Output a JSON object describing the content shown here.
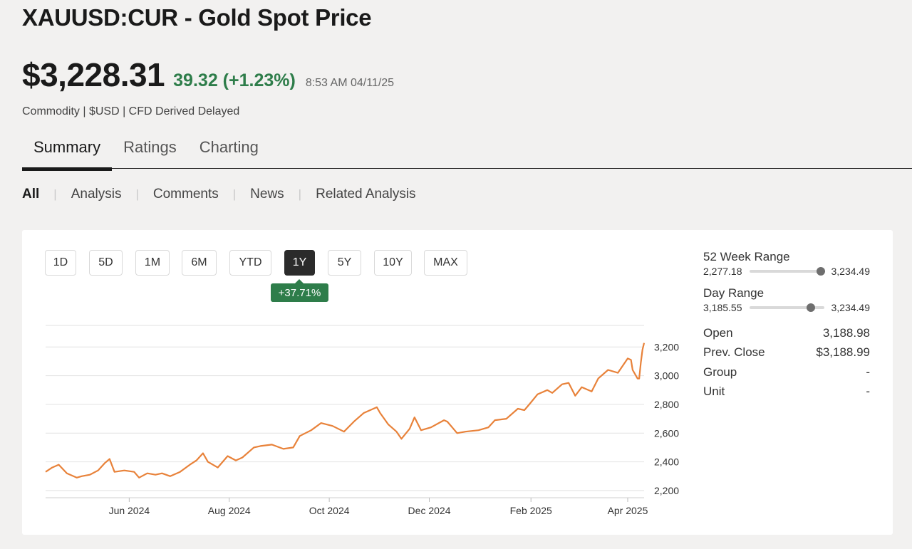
{
  "header": {
    "title": "XAUUSD:CUR - Gold Spot Price",
    "price": "$3,228.31",
    "change": "39.32 (+1.23%)",
    "time": "8:53 AM 04/11/25",
    "subtitle": "Commodity | $USD | CFD Derived Delayed"
  },
  "tabs": [
    "Summary",
    "Ratings",
    "Charting"
  ],
  "subnav": [
    "All",
    "Analysis",
    "Comments",
    "News",
    "Related Analysis"
  ],
  "ranges": [
    "1D",
    "5D",
    "1M",
    "6M",
    "YTD",
    "1Y",
    "5Y",
    "10Y",
    "MAX"
  ],
  "active_range": "1Y",
  "range_change": "+37.71%",
  "stats": {
    "week52": {
      "label": "52 Week Range",
      "low": "2,277.18",
      "high": "3,234.49",
      "position": 0.96
    },
    "day": {
      "label": "Day Range",
      "low": "3,185.55",
      "high": "3,234.49",
      "position": 0.82
    },
    "rows": [
      {
        "label": "Open",
        "value": "3,188.98"
      },
      {
        "label": "Prev. Close",
        "value": "$3,188.99"
      },
      {
        "label": "Group",
        "value": "-"
      },
      {
        "label": "Unit",
        "value": "-"
      }
    ]
  },
  "colors": {
    "line": "#e8823a",
    "up": "#2e7d4a",
    "grid": "#e2e2e2"
  },
  "chart_data": {
    "type": "line",
    "x_ticks": [
      "Jun 2024",
      "Aug 2024",
      "Oct 2024",
      "Dec 2024",
      "Feb 2025",
      "Apr 2025"
    ],
    "y_ticks": [
      "2,200",
      "2,400",
      "2,600",
      "2,800",
      "3,000",
      "3,200"
    ],
    "ylim": [
      2150,
      3350
    ],
    "xlim": [
      "2024-04-11",
      "2025-04-11"
    ],
    "series": [
      {
        "points": [
          [
            "2024-04-11",
            2330
          ],
          [
            "2024-04-15",
            2360
          ],
          [
            "2024-04-19",
            2380
          ],
          [
            "2024-04-24",
            2320
          ],
          [
            "2024-04-30",
            2290
          ],
          [
            "2024-05-03",
            2300
          ],
          [
            "2024-05-08",
            2310
          ],
          [
            "2024-05-13",
            2340
          ],
          [
            "2024-05-17",
            2390
          ],
          [
            "2024-05-20",
            2420
          ],
          [
            "2024-05-23",
            2330
          ],
          [
            "2024-05-29",
            2340
          ],
          [
            "2024-06-04",
            2330
          ],
          [
            "2024-06-07",
            2290
          ],
          [
            "2024-06-12",
            2320
          ],
          [
            "2024-06-17",
            2310
          ],
          [
            "2024-06-21",
            2320
          ],
          [
            "2024-06-26",
            2300
          ],
          [
            "2024-07-02",
            2330
          ],
          [
            "2024-07-08",
            2380
          ],
          [
            "2024-07-12",
            2410
          ],
          [
            "2024-07-16",
            2460
          ],
          [
            "2024-07-19",
            2400
          ],
          [
            "2024-07-25",
            2360
          ],
          [
            "2024-07-31",
            2440
          ],
          [
            "2024-08-05",
            2410
          ],
          [
            "2024-08-09",
            2430
          ],
          [
            "2024-08-16",
            2500
          ],
          [
            "2024-08-20",
            2510
          ],
          [
            "2024-08-27",
            2520
          ],
          [
            "2024-09-03",
            2490
          ],
          [
            "2024-09-09",
            2500
          ],
          [
            "2024-09-13",
            2580
          ],
          [
            "2024-09-20",
            2620
          ],
          [
            "2024-09-26",
            2670
          ],
          [
            "2024-10-03",
            2650
          ],
          [
            "2024-10-10",
            2610
          ],
          [
            "2024-10-16",
            2680
          ],
          [
            "2024-10-22",
            2740
          ],
          [
            "2024-10-30",
            2780
          ],
          [
            "2024-11-01",
            2740
          ],
          [
            "2024-11-06",
            2660
          ],
          [
            "2024-11-11",
            2610
          ],
          [
            "2024-11-14",
            2560
          ],
          [
            "2024-11-19",
            2630
          ],
          [
            "2024-11-22",
            2710
          ],
          [
            "2024-11-26",
            2620
          ],
          [
            "2024-12-02",
            2640
          ],
          [
            "2024-12-10",
            2690
          ],
          [
            "2024-12-12",
            2680
          ],
          [
            "2024-12-18",
            2600
          ],
          [
            "2024-12-23",
            2610
          ],
          [
            "2024-12-31",
            2620
          ],
          [
            "2025-01-06",
            2640
          ],
          [
            "2025-01-10",
            2690
          ],
          [
            "2025-01-17",
            2700
          ],
          [
            "2025-01-24",
            2770
          ],
          [
            "2025-01-28",
            2760
          ],
          [
            "2025-01-31",
            2800
          ],
          [
            "2025-02-05",
            2870
          ],
          [
            "2025-02-11",
            2900
          ],
          [
            "2025-02-14",
            2880
          ],
          [
            "2025-02-20",
            2940
          ],
          [
            "2025-02-24",
            2950
          ],
          [
            "2025-02-28",
            2860
          ],
          [
            "2025-03-04",
            2920
          ],
          [
            "2025-03-10",
            2890
          ],
          [
            "2025-03-14",
            2980
          ],
          [
            "2025-03-20",
            3040
          ],
          [
            "2025-03-26",
            3020
          ],
          [
            "2025-04-01",
            3120
          ],
          [
            "2025-04-03",
            3110
          ],
          [
            "2025-04-04",
            3040
          ],
          [
            "2025-04-07",
            2980
          ],
          [
            "2025-04-08",
            2980
          ],
          [
            "2025-04-09",
            3090
          ],
          [
            "2025-04-10",
            3180
          ],
          [
            "2025-04-11",
            3228
          ]
        ]
      }
    ]
  }
}
